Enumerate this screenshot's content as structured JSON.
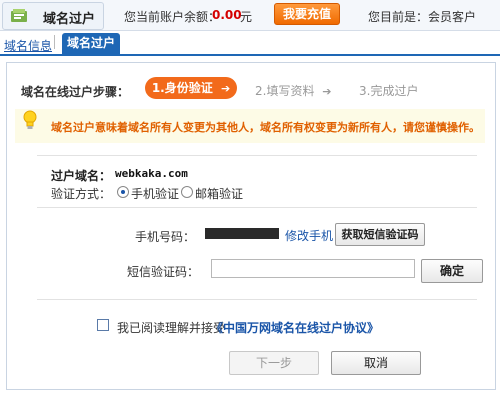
{
  "header": {
    "title": "域名过户",
    "icon": "domain-app-icon",
    "balance_label": "您当前账户余额：",
    "balance_amount": "0.00",
    "balance_unit": "元",
    "recharge_label": "我要充值",
    "current_status": "您目前是：会员客户"
  },
  "tabs": {
    "info_label": "域名信息",
    "active_label": "域名过户"
  },
  "steps": {
    "label": "域名在线过户步骤：",
    "step1": "1.身份验证",
    "step2": "2.填写资料",
    "step3": "3.完成过户",
    "arrow": "➔"
  },
  "notice": {
    "icon": "lightbulb-icon",
    "text": "域名过户意味着域名所有人变更为其他人，域名所有权变更为新所有人，请您谨慎操作。"
  },
  "form": {
    "domain_label": "过户域名：",
    "domain_value": "webkaka.com",
    "method_label": "验证方式：",
    "method_phone": "手机验证",
    "method_email": "邮箱验证",
    "phone_label": "手机号码：",
    "change_phone": "修改手机",
    "get_code": "获取短信验证码",
    "sms_label": "短信验证码：",
    "sms_value": "",
    "confirm": "确定"
  },
  "agreement": {
    "text": "我已阅读理解并接受",
    "link": "《中国万网域名在线过户协议》"
  },
  "actions": {
    "next": "下一步",
    "cancel": "取消"
  },
  "colors": {
    "accent": "#1e67b5",
    "step_active": "#f26a1b",
    "notice_text": "#e06000",
    "balance": "#d40000"
  }
}
